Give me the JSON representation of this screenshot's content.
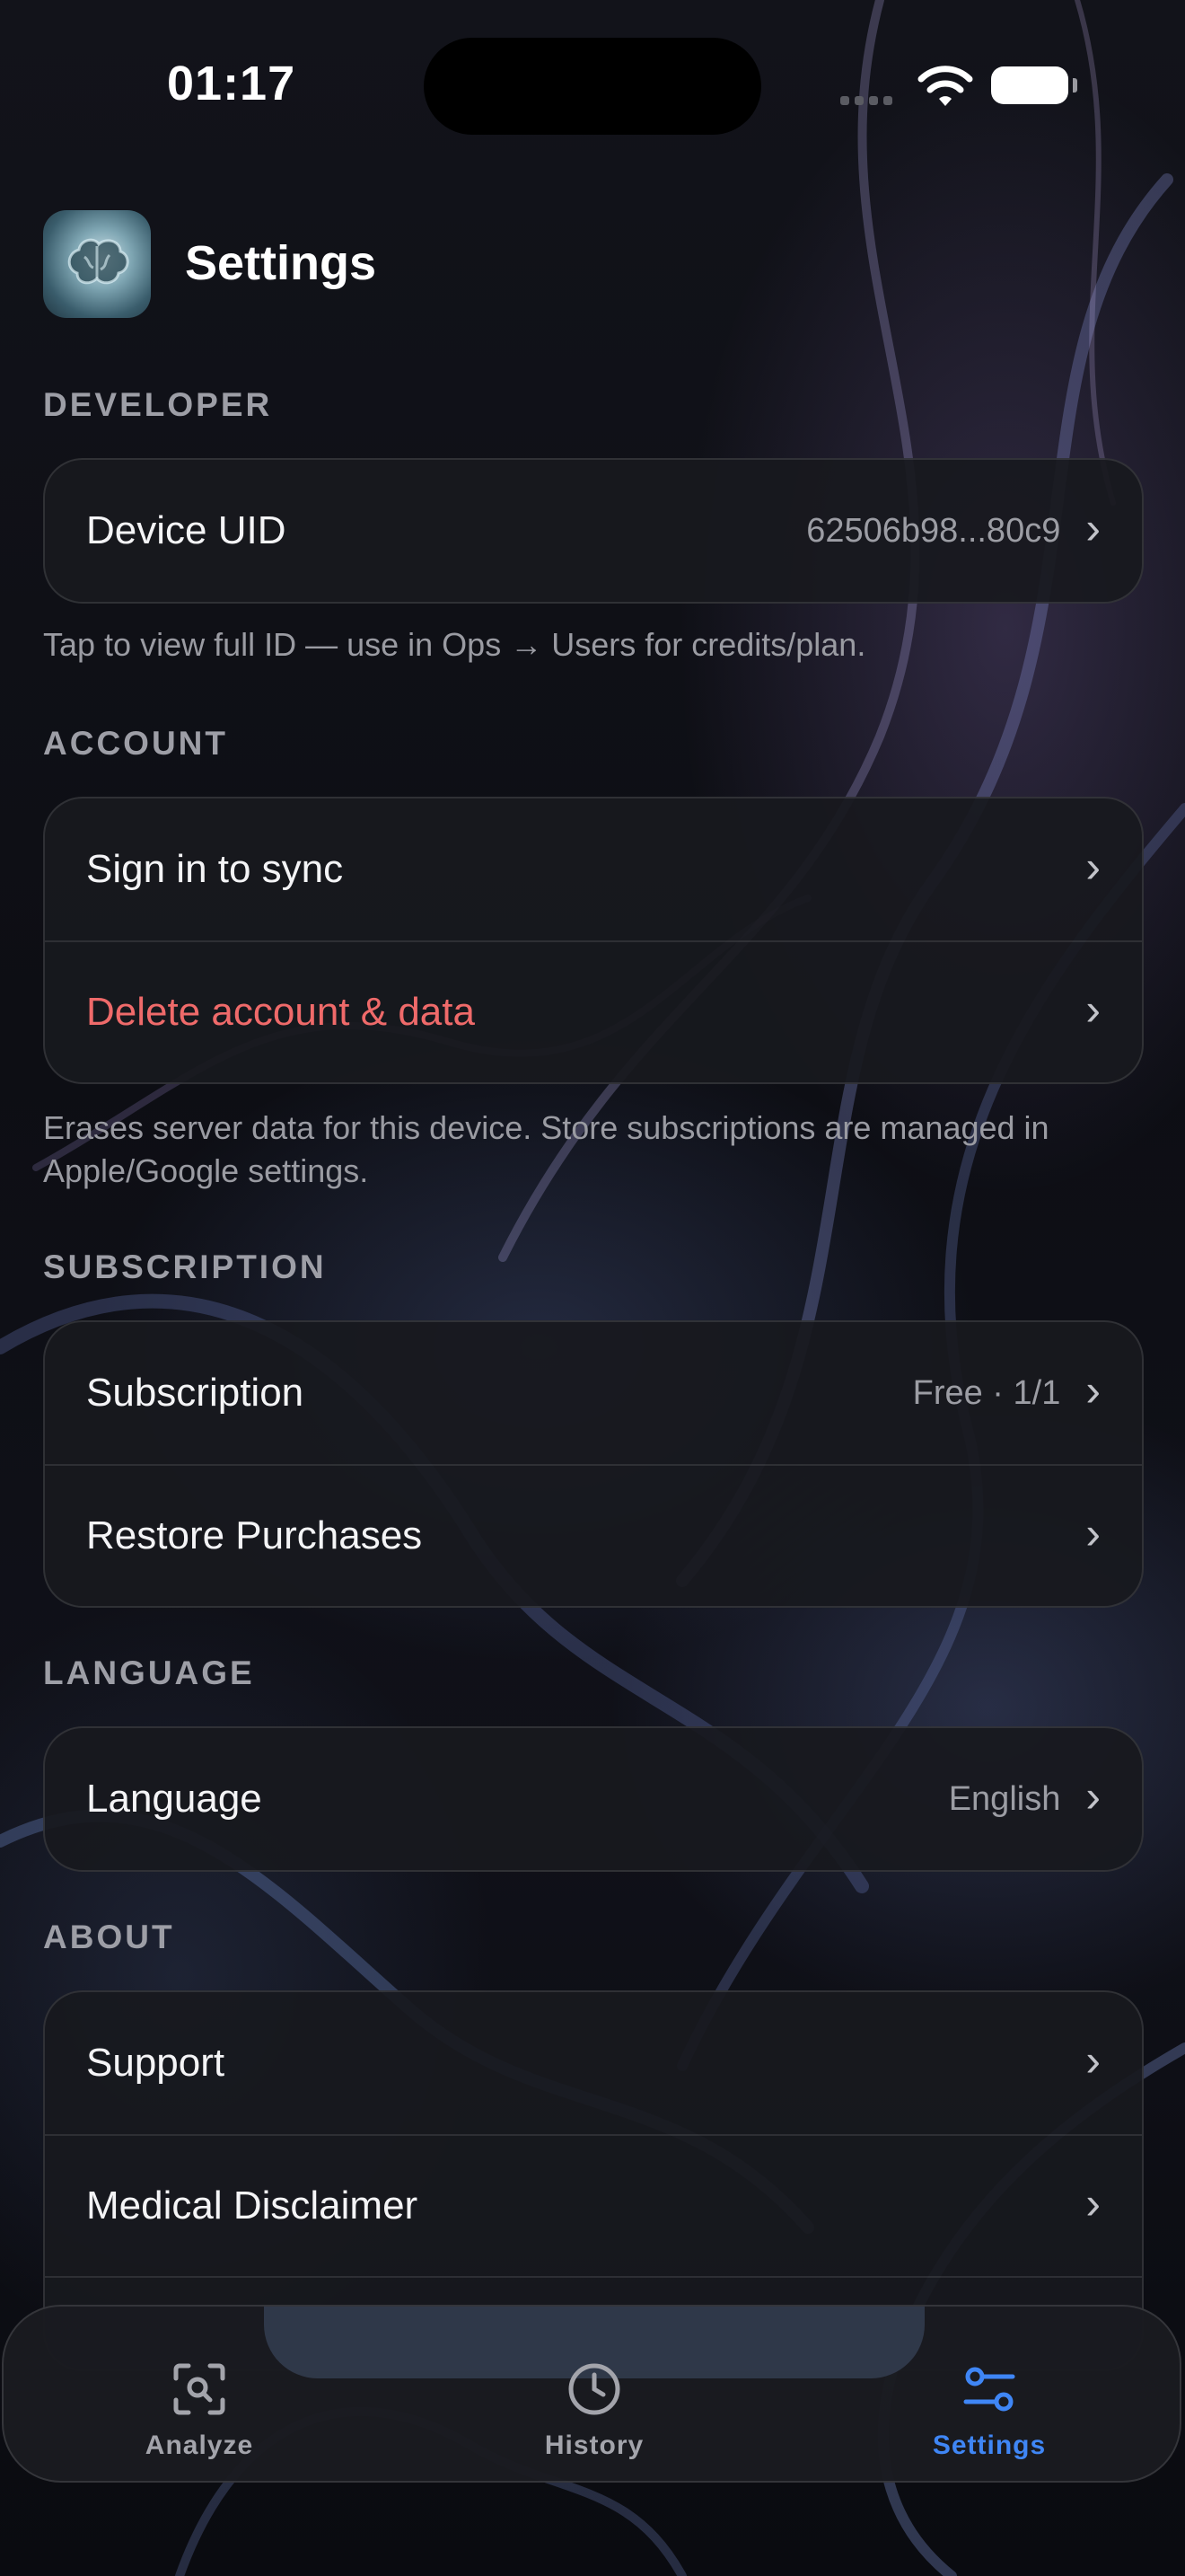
{
  "status_bar": {
    "time": "01:17"
  },
  "header": {
    "title": "Settings",
    "app_icon": "brain-app-icon"
  },
  "sections": {
    "developer": {
      "header": "DEVELOPER",
      "device_uid": {
        "label": "Device UID",
        "value": "62506b98...80c9"
      },
      "footnote": "Tap to view full ID — use in Ops → Users for credits/plan."
    },
    "account": {
      "header": "ACCOUNT",
      "sign_in": {
        "label": "Sign in to sync"
      },
      "delete": {
        "label": "Delete account & data"
      },
      "footnote": "Erases server data for this device. Store subscriptions are managed in Apple/Google settings."
    },
    "subscription": {
      "header": "SUBSCRIPTION",
      "subscription": {
        "label": "Subscription",
        "value": "Free · 1/1"
      },
      "restore": {
        "label": "Restore Purchases"
      }
    },
    "language": {
      "header": "LANGUAGE",
      "language": {
        "label": "Language",
        "value": "English"
      }
    },
    "about": {
      "header": "ABOUT",
      "support": {
        "label": "Support"
      },
      "disclaimer": {
        "label": "Medical Disclaimer"
      }
    }
  },
  "chevron": "›",
  "tab_bar": {
    "tabs": [
      {
        "label": "Analyze",
        "icon": "scan-search-icon",
        "active": false
      },
      {
        "label": "History",
        "icon": "clock-icon",
        "active": false
      },
      {
        "label": "Settings",
        "icon": "sliders-icon",
        "active": true
      }
    ]
  },
  "colors": {
    "accent": "#3f86f5",
    "danger": "#ef6a6a",
    "background": "#0b0c11",
    "card": "#18191e"
  }
}
